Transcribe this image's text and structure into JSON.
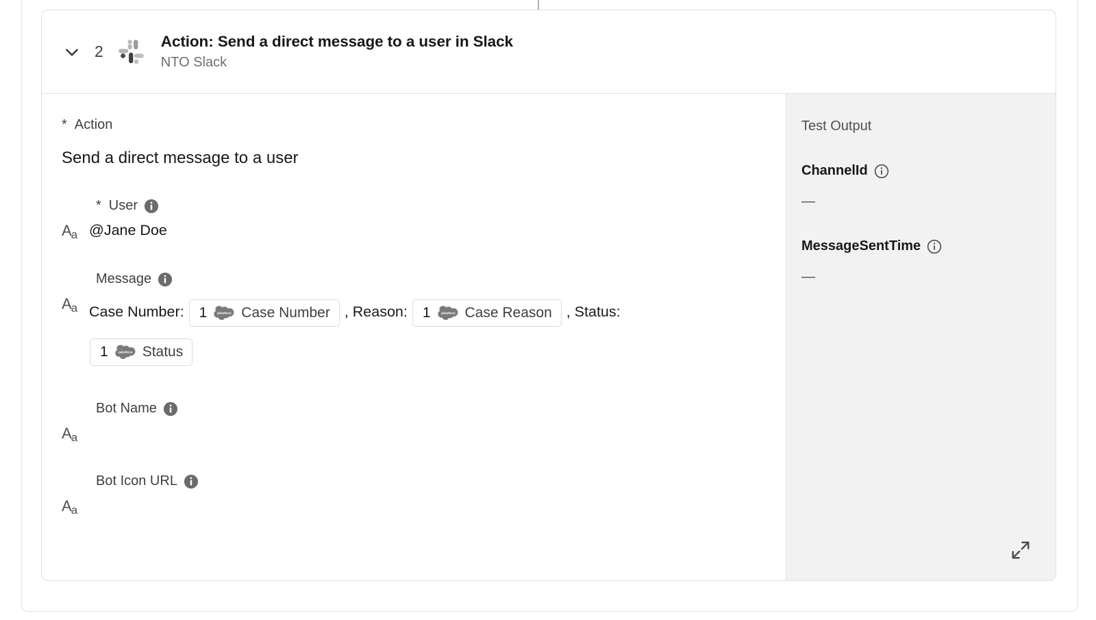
{
  "flow": {
    "connector_present": true
  },
  "card": {
    "step_number": "2",
    "title": "Action: Send a direct message to a user in Slack",
    "subtitle": "NTO Slack",
    "collapse_icon": "chevron-down-icon",
    "app_icon": "slack-icon",
    "expanded": true
  },
  "form": {
    "action_field": {
      "required": true,
      "star": "*",
      "label": "Action",
      "value": "Send a direct message to a user"
    },
    "fields": [
      {
        "required": true,
        "star": "*",
        "label": "User",
        "info_icon": "info-filled-icon",
        "type_icon": "text-format-icon",
        "value": "@Jane Doe"
      },
      {
        "required": false,
        "star": "",
        "label": "Bot Name",
        "info_icon": "info-filled-icon",
        "type_icon": "text-format-icon",
        "value": ""
      },
      {
        "required": false,
        "star": "",
        "label": "Bot Icon URL",
        "info_icon": "info-filled-icon",
        "type_icon": "text-format-icon",
        "value": ""
      }
    ],
    "message_field": {
      "label": "Message",
      "info_icon": "info-filled-icon",
      "type_icon": "text-format-icon",
      "segments": [
        {
          "kind": "text",
          "text": "Case Number: "
        },
        {
          "kind": "chip",
          "num": "1",
          "icon": "salesforce-cloud-icon",
          "label": "Case Number"
        },
        {
          "kind": "text",
          "text": " , Reason: "
        },
        {
          "kind": "chip",
          "num": "1",
          "icon": "salesforce-cloud-icon",
          "label": "Case Reason"
        },
        {
          "kind": "text",
          "text": " , Status: "
        },
        {
          "kind": "chip",
          "num": "1",
          "icon": "salesforce-cloud-icon",
          "label": "Status"
        }
      ]
    }
  },
  "test_output": {
    "title": "Test Output",
    "expand_icon": "expand-arrows-icon",
    "items": [
      {
        "name": "ChannelId",
        "info_icon": "info-outline-icon",
        "value": "—"
      },
      {
        "name": "MessageSentTime",
        "info_icon": "info-outline-icon",
        "value": "—"
      }
    ]
  },
  "colors": {
    "card_border": "#e0e0e0",
    "panel_bg": "#f2f2f2",
    "text_primary": "#181818",
    "text_secondary": "#706e6b",
    "icon_gray": "#6b6b6b"
  }
}
